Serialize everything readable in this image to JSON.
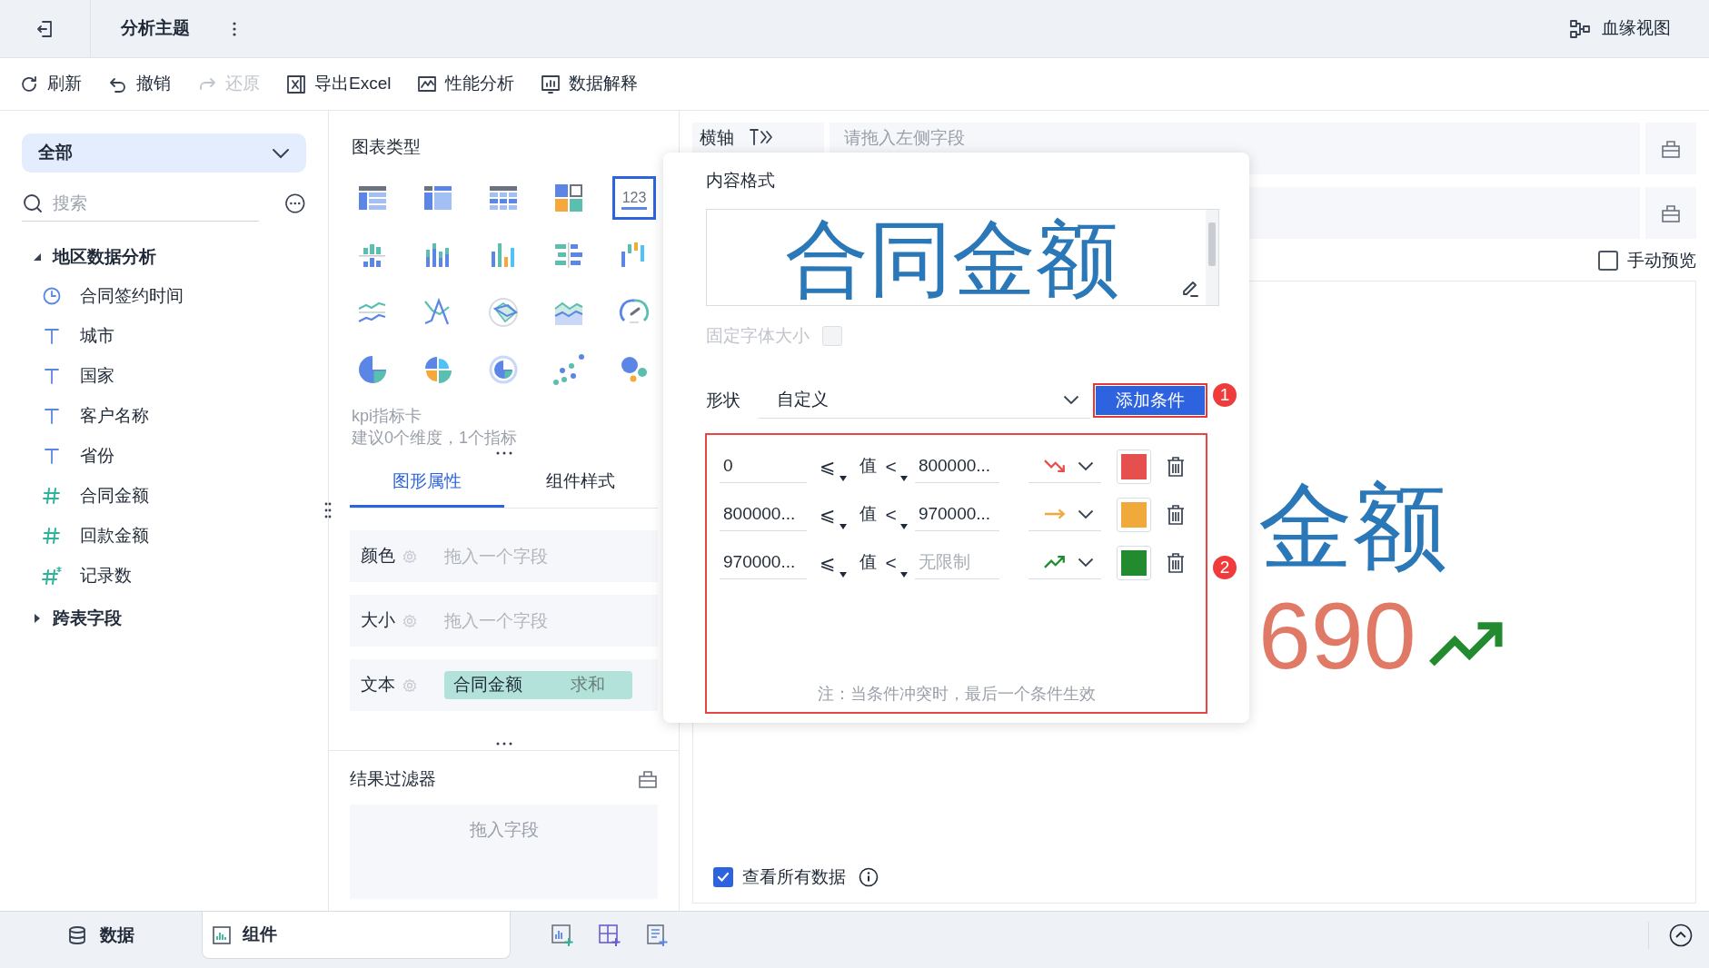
{
  "topbar": {
    "title": "分析主题",
    "lineage": "血缘视图"
  },
  "toolbar": [
    {
      "kind": "refresh",
      "label": "刷新",
      "disabled": false
    },
    {
      "kind": "undo",
      "label": "撤销",
      "disabled": false
    },
    {
      "kind": "redo",
      "label": "还原",
      "disabled": true
    },
    {
      "kind": "export",
      "label": "导出Excel",
      "disabled": false
    },
    {
      "kind": "performance",
      "label": "性能分析",
      "disabled": false
    },
    {
      "kind": "explain",
      "label": "数据解释",
      "disabled": false
    }
  ],
  "sidebar": {
    "filter": "全部",
    "search_placeholder": "搜索",
    "tree": [
      {
        "label": "地区数据分析",
        "expanded": true,
        "children": [
          {
            "kind": "date",
            "label": "合同签约时间"
          },
          {
            "kind": "text",
            "label": "城市"
          },
          {
            "kind": "text",
            "label": "国家"
          },
          {
            "kind": "text",
            "label": "客户名称"
          },
          {
            "kind": "text",
            "label": "省份"
          },
          {
            "kind": "number",
            "label": "合同金额"
          },
          {
            "kind": "number",
            "label": "回款金额"
          },
          {
            "kind": "count",
            "label": "记录数"
          }
        ]
      },
      {
        "label": "跨表字段",
        "expanded": false
      }
    ]
  },
  "chart_types": {
    "title": "图表类型",
    "items": [
      {
        "kind": "table-basic",
        "selected": false
      },
      {
        "kind": "table-group",
        "selected": false
      },
      {
        "kind": "table-detail",
        "selected": false
      },
      {
        "kind": "multi",
        "selected": false
      },
      {
        "kind": "kpi",
        "text": "123",
        "selected": true
      },
      {
        "kind": "grouped-bar",
        "selected": false
      },
      {
        "kind": "stacked-bar",
        "selected": false
      },
      {
        "kind": "bar",
        "selected": false
      },
      {
        "kind": "hbar",
        "selected": false
      },
      {
        "kind": "waterfall",
        "selected": false
      },
      {
        "kind": "line",
        "selected": false
      },
      {
        "kind": "cross-line",
        "selected": false
      },
      {
        "kind": "radar",
        "selected": false
      },
      {
        "kind": "area",
        "selected": false
      },
      {
        "kind": "gauge",
        "selected": false
      },
      {
        "kind": "pie",
        "selected": false
      },
      {
        "kind": "rose",
        "selected": false
      },
      {
        "kind": "donut",
        "selected": false
      },
      {
        "kind": "scatter",
        "selected": false
      },
      {
        "kind": "bubble",
        "selected": false
      }
    ],
    "hint_title": "kpi指标卡",
    "hint": "建议0个维度，1个指标"
  },
  "prop_tabs": [
    {
      "label": "图形属性",
      "selected": true
    },
    {
      "label": "组件样式",
      "selected": false
    }
  ],
  "properties": [
    {
      "label": "颜色",
      "placeholder": "拖入一个字段"
    },
    {
      "label": "大小",
      "placeholder": "拖入一个字段"
    },
    {
      "label": "文本",
      "field": "合同金额",
      "aggregation": "求和"
    }
  ],
  "result_filter": {
    "title": "结果过滤器",
    "placeholder": "拖入字段"
  },
  "axis": {
    "label": "横轴",
    "placeholder": "请拖入左侧字段"
  },
  "manual_preview": {
    "label": "手动预览",
    "checked": false
  },
  "preview": {
    "title": "金额",
    "value": "690"
  },
  "view_all": {
    "label": "查看所有数据",
    "checked": true
  },
  "popup": {
    "title": "内容格式",
    "preview_text": "合同金额",
    "fixed_font": {
      "label": "固定字体大小",
      "checked": false,
      "disabled": true
    },
    "shape": {
      "label": "形状",
      "value": "自定义"
    },
    "add_button": "添加条件",
    "callouts": [
      "1",
      "2"
    ],
    "conditions": [
      {
        "lower": "0",
        "lower_op": "⩽",
        "value_label": "值",
        "upper_op": "<",
        "upper": "800000...",
        "kind": "down",
        "color": "#e5504f"
      },
      {
        "lower": "800000...",
        "lower_op": "⩽",
        "value_label": "值",
        "upper_op": "<",
        "upper": "970000...",
        "kind": "flat",
        "color": "#f0a93a"
      },
      {
        "lower": "970000...",
        "lower_op": "⩽",
        "value_label": "值",
        "upper_op": "<",
        "upper_placeholder": "无限制",
        "kind": "up",
        "color": "#228b2f"
      }
    ],
    "note": "注：当条件冲突时，最后一个条件生效"
  },
  "bottom_tabs": [
    {
      "kind": "data",
      "label": "数据",
      "selected": false
    },
    {
      "kind": "component",
      "label": "组件",
      "selected": true
    }
  ]
}
